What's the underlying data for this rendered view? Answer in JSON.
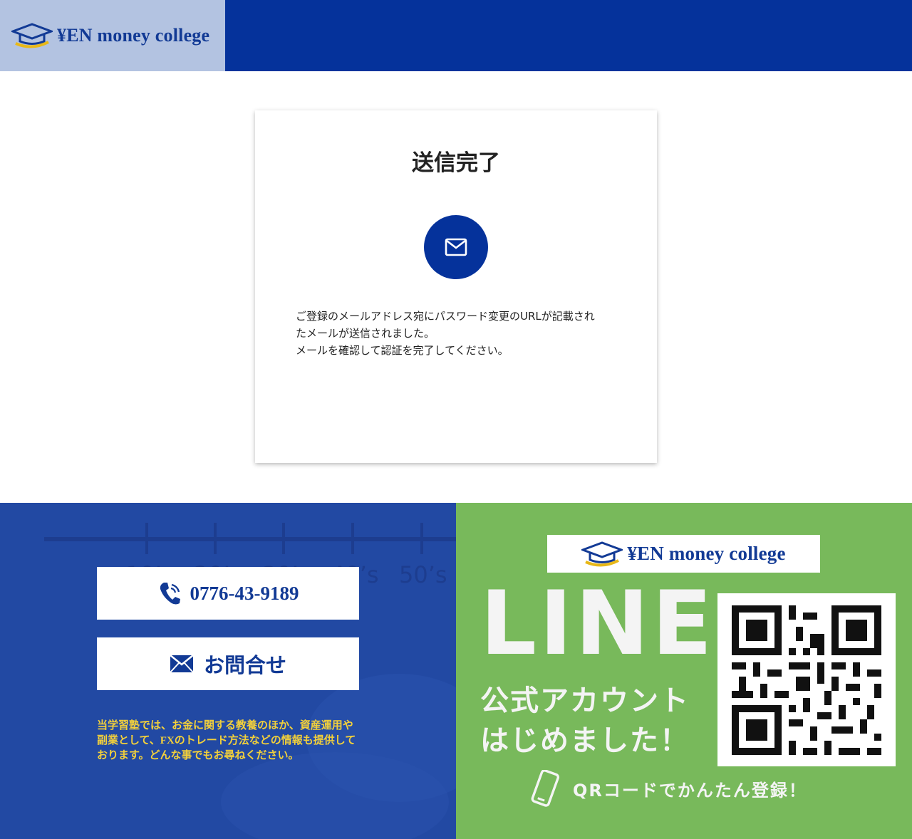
{
  "header": {
    "logo_text": "¥EN money college",
    "logo_icon": "graduation-cap-icon"
  },
  "card": {
    "title": "送信完了",
    "icon": "mail-icon",
    "message_lines": [
      "ご登録のメールアドレス宛にパスワード変更のURLが記載され",
      "たメールが送信されました。",
      "メールを確認して認証を完了してください。"
    ]
  },
  "footer": {
    "phone_label": "0776-43-9189",
    "phone_icon": "phone-icon",
    "inquiry_label": "お問合せ",
    "inquiry_icon": "envelope-icon",
    "description": "当学習塾では、お金に関する教養のほか、資産運用や副業として、FXのトレード方法などの情報も提供しております。どんな事でもお尋ねください。",
    "background_text": [
      "10’s",
      "20’s",
      "30’s",
      "40’s",
      "50’s"
    ],
    "line_banner": {
      "logo_text": "¥EN money college",
      "big_title": "LINE",
      "subtitle_line1": "公式アカウント",
      "subtitle_line2": "はじめました！",
      "cta": "QRコードでかんたん登録！",
      "cta_icon": "smartphone-icon",
      "qr_icon": "qr-code-icon"
    }
  },
  "colors": {
    "header_blue": "#05329b",
    "logo_bg": "#b3c3e1",
    "footer_blue": "#2249a3",
    "line_green": "#78b95b",
    "accent_yellow": "#f2d03b"
  }
}
